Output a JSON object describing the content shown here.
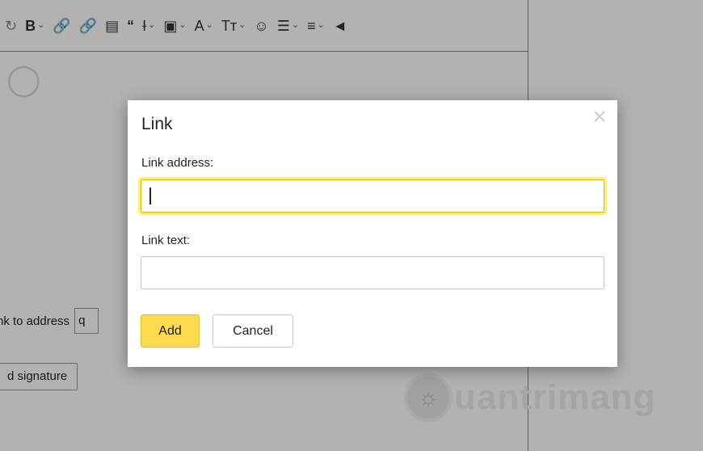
{
  "toolbar": {
    "bold_label": "B",
    "font_color_label": "A",
    "font_size_label": "Tт",
    "items": [
      "undo-icon",
      "bold-icon",
      "link-icon",
      "unlink-icon",
      "image-icon",
      "quote-icon",
      "strikethrough-icon",
      "highlight-icon",
      "font-color-icon",
      "font-size-icon",
      "emoji-icon",
      "list-icon",
      "align-icon",
      "format-painter-icon"
    ]
  },
  "background": {
    "link_to_address_label": "nk to address",
    "address_input_value": "q",
    "signature_button_label": "d signature",
    "watermark_text": "uantrimang"
  },
  "dialog": {
    "title": "Link",
    "close_label": "×",
    "link_address_label": "Link address:",
    "link_address_value": "",
    "link_text_label": "Link text:",
    "link_text_value": "",
    "add_label": "Add",
    "cancel_label": "Cancel"
  },
  "colors": {
    "accent": "#ffdb4d",
    "focus_glow": "#ffcc00",
    "overlay": "rgba(0,0,0,0.3)"
  }
}
